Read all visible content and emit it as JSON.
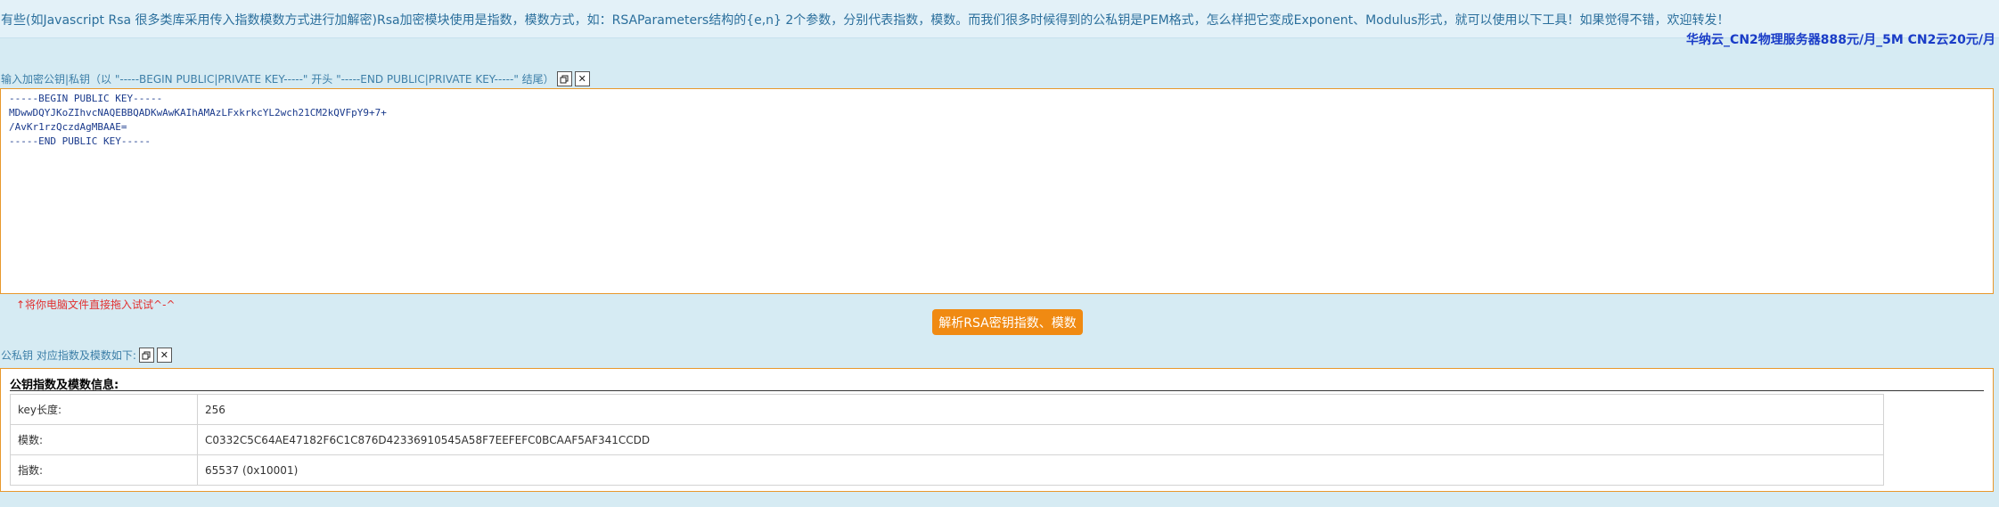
{
  "info": {
    "text": "有些(如Javascript Rsa 很多类库采用传入指数模数方式进行加解密)Rsa加密模块使用是指数，模数方式，如：RSAParameters结构的{e,n} 2个参数，分别代表指数，模数。而我们很多时候得到的公私钥是PEM格式，怎么样把它变成Exponent、Modulus形式，就可以使用以下工具！如果觉得不错，欢迎转发！",
    "promo": "华纳云_CN2物理服务器888元/月_5M CN2云20元/月"
  },
  "input_section": {
    "label": "输入加密公钥|私钥（以 \"-----BEGIN PUBLIC|PRIVATE KEY-----\" 开头 \"-----END PUBLIC|PRIVATE KEY-----\" 结尾）",
    "copy_icon": "copy-icon",
    "clear_icon": "close-icon",
    "value": "-----BEGIN PUBLIC KEY-----\nMDwwDQYJKoZIhvcNAQEBBQADKwAwKAIhAMAzLFxkrkcYL2wch21CM2kQVFpY9+7+\n/AvKr1rzQczdAgMBAAE=\n-----END PUBLIC KEY-----",
    "hint": "↑将你电脑文件直接拖入试试^-^"
  },
  "parse_button": "解析RSA密钥指数、模数",
  "output_section": {
    "label": "公私钥 对应指数及模数如下:",
    "copy_icon": "copy-icon",
    "clear_icon": "close-icon",
    "title": "公钥指数及模数信息:",
    "rows": [
      {
        "key": "key长度:",
        "value": "256"
      },
      {
        "key": "模数:",
        "value": "C0332C5C64AE47182F6C1C876D42336910545A58F7EEFEFC0BCAAF5AF341CCDD"
      },
      {
        "key": "指数:",
        "value": "65537 (0x10001)"
      }
    ]
  },
  "colors": {
    "background": "#d6ebf3",
    "accent_border": "#e8982d",
    "button": "#f08a12",
    "promo": "#1a3cc7",
    "hint": "#e23131"
  }
}
